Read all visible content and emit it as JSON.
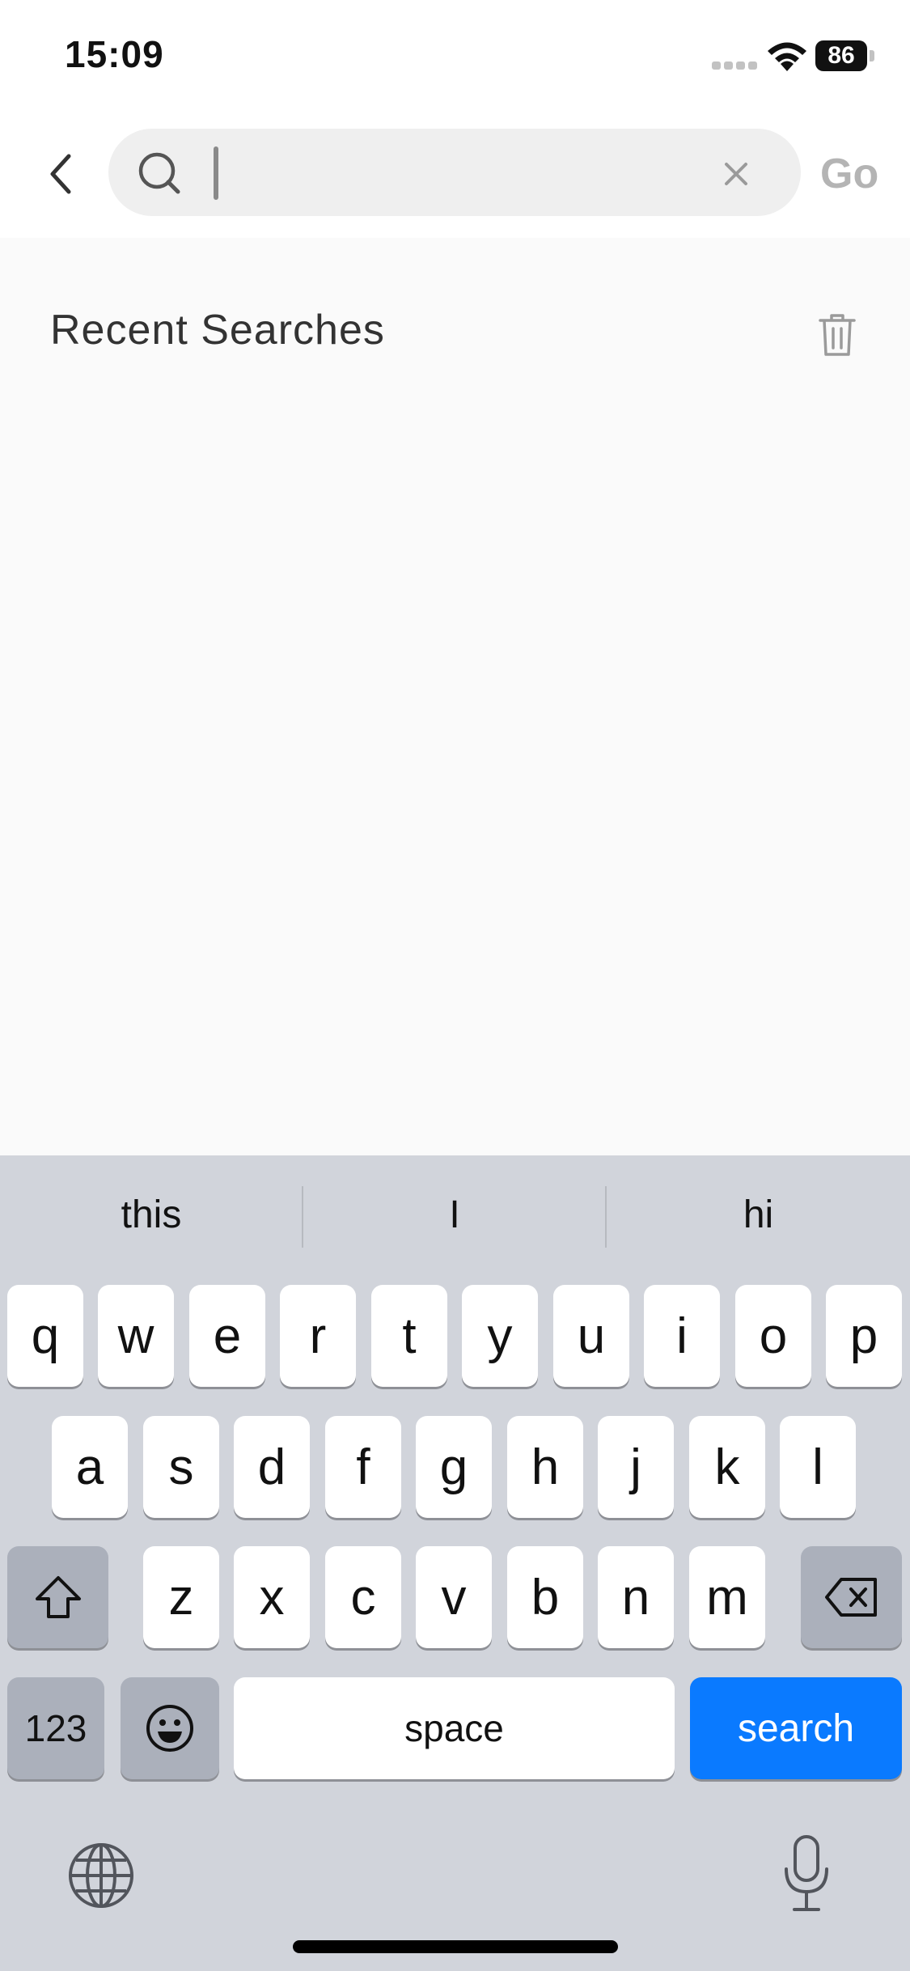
{
  "status_bar": {
    "time": "15:09",
    "battery_level": "86"
  },
  "search": {
    "placeholder": "",
    "value": "",
    "go_label": "Go"
  },
  "recent": {
    "title": "Recent Searches"
  },
  "keyboard": {
    "suggestions": [
      "this",
      "I",
      "hi"
    ],
    "row1": [
      "q",
      "w",
      "e",
      "r",
      "t",
      "y",
      "u",
      "i",
      "o",
      "p"
    ],
    "row2": [
      "a",
      "s",
      "d",
      "f",
      "g",
      "h",
      "j",
      "k",
      "l"
    ],
    "row3": [
      "z",
      "x",
      "c",
      "v",
      "b",
      "n",
      "m"
    ],
    "numbers_label": "123",
    "space_label": "space",
    "search_label": "search"
  },
  "colors": {
    "accent": "#0a7aff",
    "keyboard_bg": "#d1d4db"
  }
}
